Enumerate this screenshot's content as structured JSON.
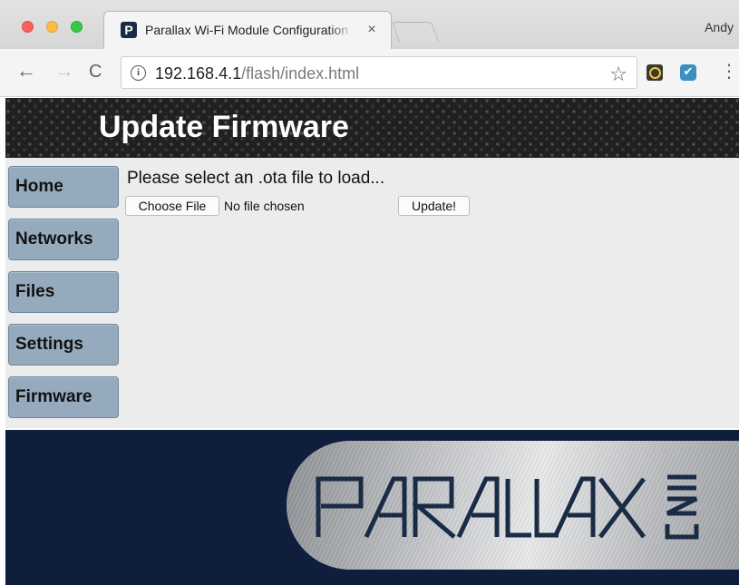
{
  "browser": {
    "tab_title": "Parallax Wi-Fi Module Configuration",
    "tab_favicon_letter": "P",
    "tab_close": "×",
    "profile_name": "Andy",
    "url_host": "192.168.4.1",
    "url_path": "/flash/index.html",
    "icons": {
      "back": "←",
      "forward": "→",
      "reload": "C",
      "info": "i",
      "star": "☆",
      "menu": "⋮",
      "ext_check": "✔"
    }
  },
  "page": {
    "title": "Update Firmware",
    "nav": [
      {
        "label": "Home"
      },
      {
        "label": "Networks"
      },
      {
        "label": "Files"
      },
      {
        "label": "Settings"
      },
      {
        "label": "Firmware"
      }
    ],
    "prompt": "Please select an .ota file to load...",
    "choose_file_label": "Choose File",
    "file_status": "No file chosen",
    "update_label": "Update!",
    "logo_text": "PARALLAX INC"
  },
  "colors": {
    "nav_button": "#95abbd",
    "footer_bg": "#0f1e3c",
    "header_bg": "#202020",
    "logo_ink": "#1a2b45"
  }
}
